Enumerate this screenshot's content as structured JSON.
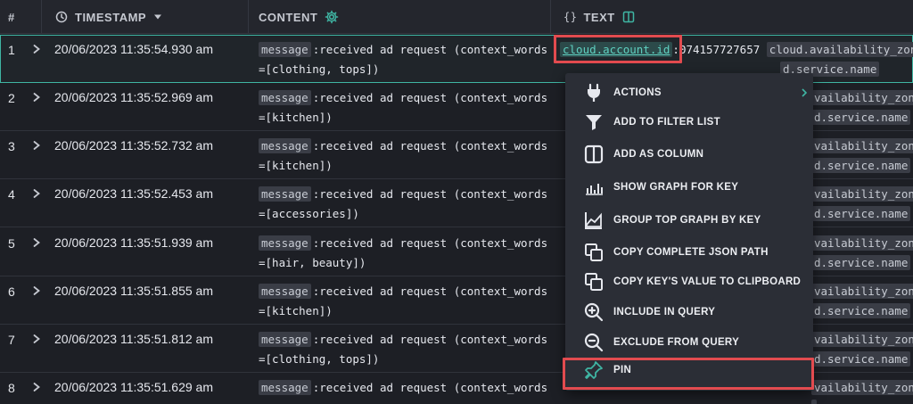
{
  "header": {
    "num_label": "#",
    "timestamp_label": "TIMESTAMP",
    "content_label": "CONTENT",
    "text_label": "TEXT",
    "text_prefix": "{}"
  },
  "rows": [
    {
      "num": "1",
      "timestamp": "20/06/2023 11:35:54.930 am",
      "content_key": "message",
      "content_line1": "received ad request (context_words",
      "content_line2": "=[clothing, tops])",
      "text_line1_key": "cloud.account.id",
      "text_line1_val": "074157727657",
      "text_line1_key2": "cloud.availability_zone",
      "text_line2": "d.service.name"
    },
    {
      "num": "2",
      "timestamp": "20/06/2023 11:35:52.969 am",
      "content_key": "message",
      "content_line1": "received ad request (context_words",
      "content_line2": "=[kitchen])",
      "text_line1_key2": "vailability_zone",
      "text_line2": "d.service.name"
    },
    {
      "num": "3",
      "timestamp": "20/06/2023 11:35:52.732 am",
      "content_key": "message",
      "content_line1": "received ad request (context_words",
      "content_line2": "=[kitchen])",
      "text_line1_key2": "vailability_zone",
      "text_line2": "d.service.name"
    },
    {
      "num": "4",
      "timestamp": "20/06/2023 11:35:52.453 am",
      "content_key": "message",
      "content_line1": "received ad request (context_words",
      "content_line2": "=[accessories])",
      "text_line1_key2": "vailability_zone",
      "text_line2": "d.service.name"
    },
    {
      "num": "5",
      "timestamp": "20/06/2023 11:35:51.939 am",
      "content_key": "message",
      "content_line1": "received ad request (context_words",
      "content_line2": "=[hair, beauty])",
      "text_line1_key2": "vailability_zone",
      "text_line2": "d.service.name"
    },
    {
      "num": "6",
      "timestamp": "20/06/2023 11:35:51.855 am",
      "content_key": "message",
      "content_line1": "received ad request (context_words",
      "content_line2": "=[kitchen])",
      "text_line1_key2": "vailability_zone",
      "text_line2": "d.service.name"
    },
    {
      "num": "7",
      "timestamp": "20/06/2023 11:35:51.812 am",
      "content_key": "message",
      "content_line1": "received ad request (context_words",
      "content_line2": "=[clothing, tops])",
      "text_line1_key2": "vailability_zone",
      "text_line2": "d.service.name"
    },
    {
      "num": "8",
      "timestamp": "20/06/2023 11:35:51.629 am",
      "content_key": "message",
      "content_line1": "received ad request (context_words",
      "content_line2": "",
      "text_line1_key2": "vailability_zone",
      "text_line2": ""
    }
  ],
  "menu": {
    "items": [
      {
        "label": "ACTIONS",
        "icon": "plug-icon"
      },
      {
        "label": "ADD TO FILTER LIST",
        "icon": "filter-icon"
      },
      {
        "label": "ADD AS COLUMN",
        "icon": "column-icon"
      },
      {
        "label": "SHOW GRAPH FOR KEY",
        "icon": "bar-chart-icon"
      },
      {
        "label": "GROUP TOP GRAPH BY KEY",
        "icon": "area-chart-icon"
      },
      {
        "label": "COPY COMPLETE JSON PATH",
        "icon": "copy-icon"
      },
      {
        "label": "COPY KEY'S VALUE TO CLIPBOARD",
        "icon": "copy-icon"
      },
      {
        "label": "INCLUDE IN QUERY",
        "icon": "zoom-in-icon"
      },
      {
        "label": "EXCLUDE FROM QUERY",
        "icon": "zoom-out-icon"
      },
      {
        "label": "PIN",
        "icon": "pin-icon"
      }
    ]
  },
  "colors": {
    "accent": "#3fb5a3",
    "highlight": "#e24b4f",
    "background": "#1d1f25",
    "menu": "#2b2e36"
  }
}
